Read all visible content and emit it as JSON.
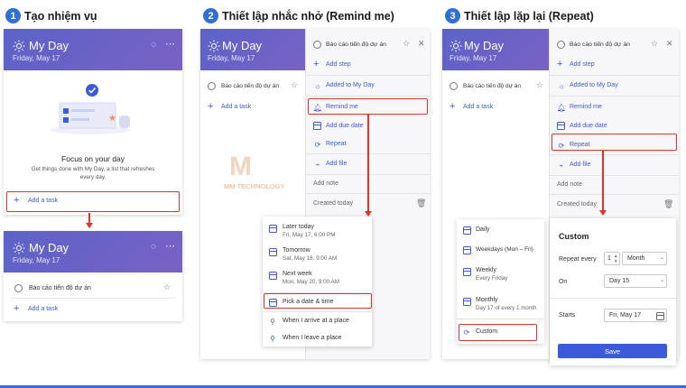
{
  "steps": [
    {
      "num": "1",
      "title": "Tạo nhiệm vụ"
    },
    {
      "num": "2",
      "title": "Thiết lập nhắc nhở (Remind me)"
    },
    {
      "num": "3",
      "title": "Thiết lập lặp lại (Repeat)"
    }
  ],
  "myday": {
    "title": "My Day",
    "date": "Friday, May 17"
  },
  "empty_state": {
    "heading": "Focus on your day",
    "body_line1": "Get things done with My Day, a list that refreshes",
    "body_line2": "every day."
  },
  "task": {
    "name": "Báo cáo tiến độ dự án",
    "add_task": "Add a task"
  },
  "details": {
    "add_step": "Add step",
    "added_to_my_day": "Added to My Day",
    "remind_me": "Remind me",
    "add_due_date": "Add due date",
    "repeat": "Repeat",
    "add_file": "Add file",
    "add_note": "Add note",
    "created_today": "Created today"
  },
  "watermark": {
    "letter": "M",
    "text": "MM TECHNOLOGY"
  },
  "remind_menu": [
    {
      "label": "Later today",
      "sub": "Fri, May 17, 6:00 PM",
      "icon": "calendar-icon"
    },
    {
      "label": "Tomorrow",
      "sub": "Sat, May 18, 9:00 AM",
      "icon": "calendar-icon"
    },
    {
      "label": "Next week",
      "sub": "Mon, May 20, 9:00 AM",
      "icon": "calendar-icon"
    },
    {
      "label": "Pick a date & time",
      "sub": "",
      "icon": "calendar-icon"
    },
    {
      "label": "When I arrive at a place",
      "sub": "",
      "icon": "location-icon"
    },
    {
      "label": "When I leave a place",
      "sub": "",
      "icon": "location-icon"
    }
  ],
  "repeat_menu": [
    {
      "label": "Daily",
      "sub": ""
    },
    {
      "label": "Weekdays (Mon – Fri)",
      "sub": ""
    },
    {
      "label": "Weekly",
      "sub": "Every Friday"
    },
    {
      "label": "Monthly",
      "sub": "Day 17 of every 1 month"
    },
    {
      "label": "Custom",
      "sub": ""
    }
  ],
  "custom": {
    "title": "Custom",
    "repeat_every_label": "Repeat every",
    "repeat_every_value": "1",
    "unit": "Month",
    "on_label": "On",
    "on_value": "Day 15",
    "starts_label": "Starts",
    "starts_value": "Fri, May 17",
    "save": "Save"
  },
  "colors": {
    "accent": "#3b5bdb",
    "highlight": "#e0322b",
    "header": "#6a62c6"
  }
}
